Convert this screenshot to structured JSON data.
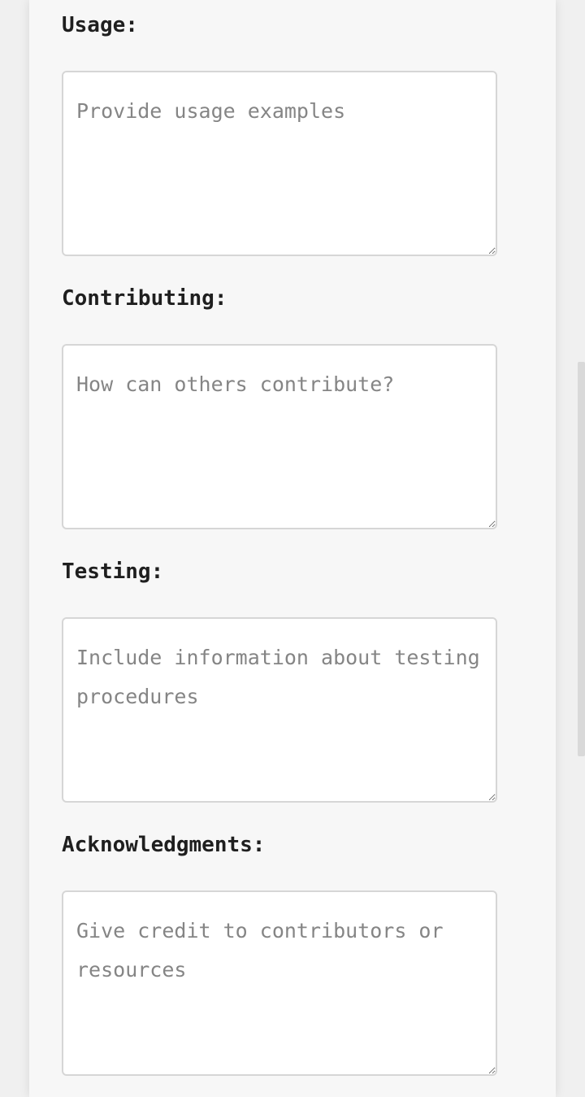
{
  "form": {
    "usage": {
      "label": "Usage:",
      "placeholder": "Provide usage examples",
      "value": ""
    },
    "contributing": {
      "label": "Contributing:",
      "placeholder": "How can others contribute?",
      "value": ""
    },
    "testing": {
      "label": "Testing:",
      "placeholder": "Include information about testing procedures",
      "value": ""
    },
    "acknowledgments": {
      "label": "Acknowledgments:",
      "placeholder": "Give credit to contributors or resources",
      "value": ""
    }
  },
  "colors": {
    "page_background": "#f0f0f0",
    "card_background": "#f7f7f7",
    "field_border": "#d6d6d6",
    "label_text": "#1f1f1f",
    "placeholder_text": "#858585"
  }
}
